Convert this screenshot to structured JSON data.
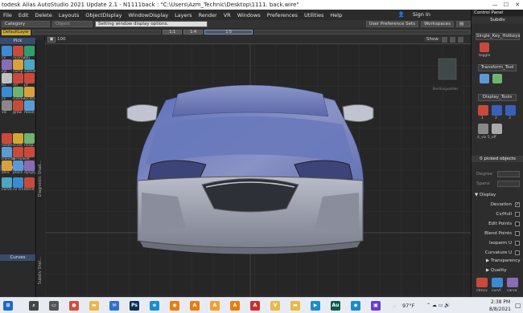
{
  "window": {
    "title": "todesk Alias AutoStudio 2021 Update 2.1   - N1111back : \"C:\\Users\\Azm_Technic\\Desktop\\1111. back.wire\"",
    "controls": [
      "—",
      "☐",
      "✕"
    ]
  },
  "menu": [
    "File",
    "Edit",
    "Delete",
    "Layouts",
    "ObjectDisplay",
    "WindowDisplay",
    "Layers",
    "Render",
    "VR",
    "Windows",
    "Preferences",
    "Utilities",
    "Help"
  ],
  "sign_in": "Sign In",
  "toolbar": {
    "category": "Category",
    "object": "Object",
    "tooltip": "Setting window display options.",
    "user_pref_sets": "User Preference Sets",
    "workspaces": "Workspaces",
    "layer_name": "DefaultLayer",
    "seg_values": [
      "1:1",
      "1:4",
      "1:5"
    ]
  },
  "viewport": {
    "zoom": "100",
    "show_label": "Show",
    "side_label": "Berlinspodder"
  },
  "left_palette": {
    "sections": [
      "Pick",
      "Transform",
      "Curves"
    ],
    "tools": [
      {
        "label": "cv",
        "color": "#3b8bd4"
      },
      {
        "label": "ncomp",
        "color": "#c94a3a"
      },
      {
        "label": "obj",
        "color": "#2f9e6b"
      },
      {
        "label": "cyl",
        "color": "#8a6bb8"
      },
      {
        "label": "comp",
        "color": "#d9a13b"
      },
      {
        "label": "subset",
        "color": "#4aa8c0"
      },
      {
        "label": "lcl",
        "color": "#c0c0c0"
      },
      {
        "label": "ref",
        "color": "#c94a3a"
      },
      {
        "label": "pt",
        "color": "#c94a3a"
      },
      {
        "label": "cv",
        "color": "#3b8bd4"
      },
      {
        "label": "subdiv",
        "color": "#6fb36f"
      },
      {
        "label": "locator",
        "color": "#d9a13b"
      },
      {
        "label": "vis",
        "color": "#888"
      },
      {
        "label": "grow",
        "color": "#c94a3a"
      },
      {
        "label": "move",
        "color": "#5a9bd4"
      },
      {
        "label": "rotate",
        "color": "#c94a3a"
      },
      {
        "label": "scale",
        "color": "#d4a830"
      },
      {
        "label": "nonp",
        "color": "#6fb36f"
      },
      {
        "label": "transfm",
        "color": "#5a9bd4"
      },
      {
        "label": "p mod",
        "color": "#c94a3a"
      },
      {
        "label": "set",
        "color": "#c94a3a"
      },
      {
        "label": "zero",
        "color": "#d9a13b"
      },
      {
        "label": "place",
        "color": "#5a9bd4"
      },
      {
        "label": "dynply",
        "color": "#8a6bb8"
      },
      {
        "label": "curve",
        "color": "#4aa8c0"
      },
      {
        "label": "cv crv",
        "color": "#3b8bd4"
      },
      {
        "label": "blend",
        "color": "#c94a3a"
      }
    ],
    "shelf_labels": [
      "Diagnostic Shad...",
      "Subdiv Shel..."
    ]
  },
  "right_panel": {
    "header": "Control Panel",
    "subheader": "Subdiv",
    "shelf_tabs": [
      "Single_Key_Hotkeys",
      "Transform_Tool",
      "Display_Tools"
    ],
    "single_key_label": "toggle",
    "display_items": [
      "1",
      "2",
      "3"
    ],
    "more_label": "4_vis  5_off",
    "picked": "0 picked objects",
    "degree_label": "Degree",
    "spans_label": "Spans",
    "display_header": "Display",
    "options": [
      {
        "label": "Deviation",
        "checked": true
      },
      {
        "label": "Cv/Hull",
        "checked": false
      },
      {
        "label": "Edit Points",
        "checked": false
      },
      {
        "label": "Blend Points",
        "checked": false
      },
      {
        "label": "Isoparm U",
        "checked": false
      },
      {
        "label": "Curvature U",
        "checked": false
      }
    ],
    "transparency": "Transparency",
    "quality": "Quality",
    "bottom_tools": [
      "ctmcv",
      "curvf",
      "carva"
    ]
  },
  "taskbar": {
    "weather": "97°F",
    "time": "2:38 PM",
    "date": "8/8/2021",
    "apps": [
      {
        "name": "search",
        "color": "#444",
        "glyph": "⌕"
      },
      {
        "name": "taskview",
        "color": "#555",
        "glyph": "▭"
      },
      {
        "name": "chrome",
        "color": "#d64b3b",
        "glyph": "●"
      },
      {
        "name": "explorer",
        "color": "#e8b84a",
        "glyph": "▬"
      },
      {
        "name": "mail",
        "color": "#2f6fd0",
        "glyph": "✉"
      },
      {
        "name": "photoshop",
        "color": "#0b2e5a",
        "glyph": "Ps"
      },
      {
        "name": "edge",
        "color": "#1b8bd0",
        "glyph": "e"
      },
      {
        "name": "blender",
        "color": "#e87d0d",
        "glyph": "◉"
      },
      {
        "name": "alias1",
        "color": "#e87d0d",
        "glyph": "A"
      },
      {
        "name": "alias2",
        "color": "#f0a030",
        "glyph": "A"
      },
      {
        "name": "alias3",
        "color": "#e87d0d",
        "glyph": "A"
      },
      {
        "name": "acrobat",
        "color": "#c9302c",
        "glyph": "A"
      },
      {
        "name": "vred",
        "color": "#e8b84a",
        "glyph": "V"
      },
      {
        "name": "files",
        "color": "#e8b84a",
        "glyph": "▬"
      },
      {
        "name": "media",
        "color": "#1b8bd0",
        "glyph": "▶"
      },
      {
        "name": "audition",
        "color": "#0e5a4a",
        "glyph": "Au"
      },
      {
        "name": "app2",
        "color": "#1b8bd0",
        "glyph": "◆"
      },
      {
        "name": "app3",
        "color": "#6b3bd0",
        "glyph": "▣"
      }
    ]
  },
  "colors": {
    "body_paint": "#6d7fb8",
    "highlight": "#c8ccd6",
    "accent_section": "#3a4a6a"
  }
}
